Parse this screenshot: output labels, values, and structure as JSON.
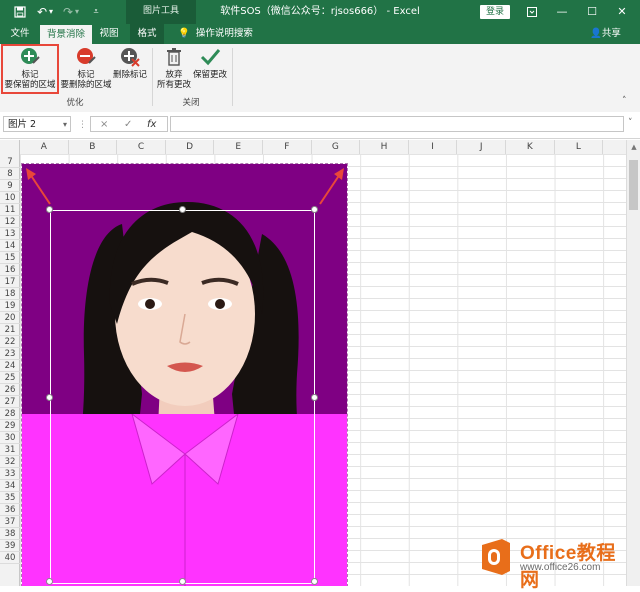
{
  "titlebar": {
    "window_title": "软件SOS（微信公众号：rjsos666） - Excel",
    "context_tool": "图片工具",
    "login_label": "登录",
    "save_icon": "save-icon",
    "undo_icon": "undo-icon",
    "redo_icon": "redo-icon"
  },
  "tabs": {
    "items": [
      "文件",
      "背景消除",
      "视图",
      "格式"
    ],
    "active": "背景消除",
    "tell_me": "操作说明搜索",
    "share": "共享"
  },
  "ribbon": {
    "buttons": {
      "mark_keep": [
        "标记",
        "要保留的区域"
      ],
      "mark_remove": [
        "标记",
        "要删除的区域"
      ],
      "delete_mark": "删除标记",
      "discard": [
        "放弃",
        "所有更改"
      ],
      "keep_changes": "保留更改"
    },
    "groups": {
      "optimize": "优化",
      "close": "关闭"
    },
    "accent": "#e8473a"
  },
  "formula_bar": {
    "name_box": "图片 2",
    "cancel_glyph": "×",
    "enter_glyph": "✓",
    "fx_glyph": "fx",
    "value": ""
  },
  "grid": {
    "columns": [
      "A",
      "B",
      "C",
      "D",
      "E",
      "F",
      "G",
      "H",
      "I",
      "J",
      "K",
      "L"
    ],
    "rows": [
      "7",
      "8",
      "9",
      "10",
      "11",
      "12",
      "13",
      "14",
      "15",
      "16",
      "17",
      "18",
      "19",
      "20",
      "21",
      "22",
      "23",
      "24",
      "25",
      "26",
      "27",
      "28",
      "29",
      "30",
      "31",
      "32",
      "33",
      "34",
      "35",
      "36",
      "37",
      "38",
      "39",
      "40"
    ]
  },
  "picture": {
    "background_color": "#7f0083",
    "shirt_color": "#ff33ff",
    "subject": "portrait-photo"
  },
  "watermark": {
    "brand": "Office教程网",
    "url": "www.office26.com"
  }
}
